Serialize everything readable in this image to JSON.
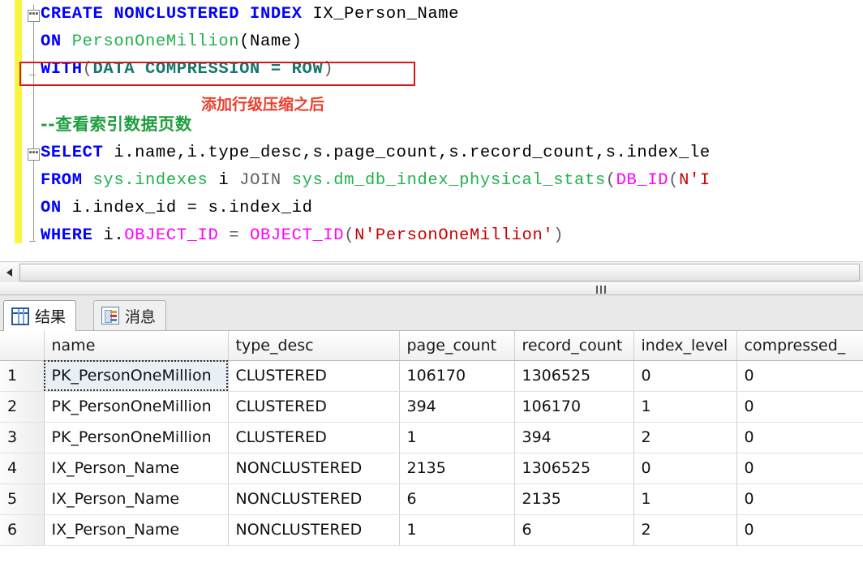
{
  "editor": {
    "lines": [
      {
        "id": "l1",
        "tokens": [
          {
            "t": "CREATE NONCLUSTERED INDEX ",
            "c": "kw"
          },
          {
            "t": "IX_Person_Name",
            "c": "plain"
          }
        ]
      },
      {
        "id": "l2",
        "tokens": [
          {
            "t": "ON ",
            "c": "kw"
          },
          {
            "t": "PersonOneMillion",
            "c": "tbl"
          },
          {
            "t": "(Name)",
            "c": "plain"
          }
        ]
      },
      {
        "id": "l3",
        "tokens": [
          {
            "t": "WITH",
            "c": "kw"
          },
          {
            "t": "(",
            "c": "punct"
          },
          {
            "t": "DATA COMPRESSION = ROW",
            "c": "tealkw"
          },
          {
            "t": ")",
            "c": "punct"
          }
        ]
      },
      {
        "id": "l4",
        "tokens": [
          {
            "t": "--查看索引数据页数",
            "c": "cmt"
          }
        ]
      },
      {
        "id": "l5",
        "tokens": [
          {
            "t": "SELECT ",
            "c": "kw"
          },
          {
            "t": "i.name,i.type_desc,s.page_count,s.record_count,s.index_le",
            "c": "plain"
          }
        ]
      },
      {
        "id": "l6",
        "tokens": [
          {
            "t": "FROM ",
            "c": "kw"
          },
          {
            "t": "sys.indexes",
            "c": "tbl"
          },
          {
            "t": " i ",
            "c": "plain"
          },
          {
            "t": "JOIN ",
            "c": "punct"
          },
          {
            "t": "sys.dm_db_index_physical_stats",
            "c": "tbl"
          },
          {
            "t": "(",
            "c": "punct"
          },
          {
            "t": "DB_ID",
            "c": "func"
          },
          {
            "t": "(",
            "c": "punct"
          },
          {
            "t": "N'I",
            "c": "str"
          }
        ]
      },
      {
        "id": "l7",
        "tokens": [
          {
            "t": "ON ",
            "c": "kw"
          },
          {
            "t": "i.index_id = s.index_id",
            "c": "plain"
          }
        ]
      },
      {
        "id": "l8",
        "tokens": [
          {
            "t": "WHERE ",
            "c": "kw"
          },
          {
            "t": "i.",
            "c": "plain"
          },
          {
            "t": "OBJECT_ID",
            "c": "func"
          },
          {
            "t": " = ",
            "c": "punct"
          },
          {
            "t": "OBJECT_ID",
            "c": "func"
          },
          {
            "t": "(",
            "c": "punct"
          },
          {
            "t": "N'PersonOneMillion'",
            "c": "str"
          },
          {
            "t": ")",
            "c": "punct"
          }
        ]
      }
    ],
    "annotation": "添加行级压缩之后",
    "annotation_color": "#e8402f",
    "highlight_box_color": "#d81616",
    "change_bar_color": "#fcf53f"
  },
  "tabs": [
    {
      "label": "结果",
      "icon": "grid-icon",
      "active": true
    },
    {
      "label": "消息",
      "icon": "message-icon",
      "active": false
    }
  ],
  "grid": {
    "columns": [
      "name",
      "type_desc",
      "page_count",
      "record_count",
      "index_level",
      "compressed_"
    ],
    "rows": [
      {
        "num": "1",
        "name": "PK_PersonOneMillion",
        "type_desc": "CLUSTERED",
        "page_count": "106170",
        "record_count": "1306525",
        "index_level": "0",
        "compressed": "0",
        "selected": true
      },
      {
        "num": "2",
        "name": "PK_PersonOneMillion",
        "type_desc": "CLUSTERED",
        "page_count": "394",
        "record_count": "106170",
        "index_level": "1",
        "compressed": "0",
        "selected": false
      },
      {
        "num": "3",
        "name": "PK_PersonOneMillion",
        "type_desc": "CLUSTERED",
        "page_count": "1",
        "record_count": "394",
        "index_level": "2",
        "compressed": "0",
        "selected": false
      },
      {
        "num": "4",
        "name": "IX_Person_Name",
        "type_desc": "NONCLUSTERED",
        "page_count": "2135",
        "record_count": "1306525",
        "index_level": "0",
        "compressed": "0",
        "selected": false
      },
      {
        "num": "5",
        "name": "IX_Person_Name",
        "type_desc": "NONCLUSTERED",
        "page_count": "6",
        "record_count": "2135",
        "index_level": "1",
        "compressed": "0",
        "selected": false
      },
      {
        "num": "6",
        "name": "IX_Person_Name",
        "type_desc": "NONCLUSTERED",
        "page_count": "1",
        "record_count": "6",
        "index_level": "2",
        "compressed": "0",
        "selected": false
      }
    ]
  }
}
